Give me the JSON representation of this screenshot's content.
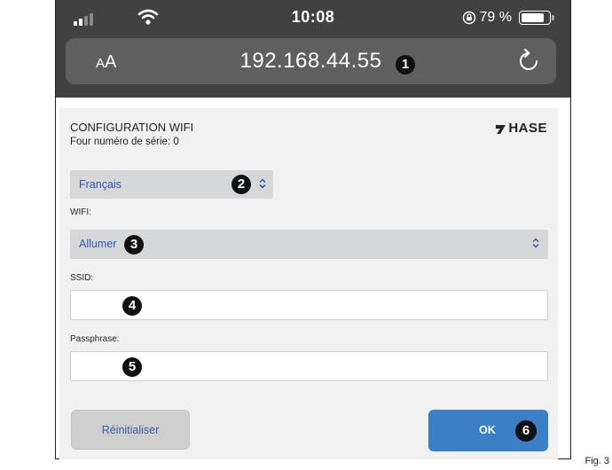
{
  "status_bar": {
    "time": "10:08",
    "battery": "79 %",
    "battery_level": 0.74
  },
  "browser": {
    "text_size_label_small": "A",
    "text_size_label_large": "A",
    "url": "192.168.44.55"
  },
  "markers": [
    "1",
    "2",
    "3",
    "4",
    "5",
    "6"
  ],
  "config": {
    "title": "CONFIGURATION WIFI",
    "subtitle": "Four numéro de série: 0",
    "logo": "HASE",
    "language": "Français",
    "wifi_label": "WIFI:",
    "wifi_value": "Allumer",
    "ssid_label": "SSID:",
    "ssid_value": "",
    "passphrase_label": "Passphrase:",
    "passphrase_value": "",
    "reset_label": "Réinitialiser",
    "ok_label": "OK"
  },
  "figure_label": "Fig. 3",
  "colors": {
    "browser_chrome": "#414141",
    "url_bar": "#5f5f5f",
    "panel_bg": "#f1f1f1",
    "select_bg": "#d6d7d9",
    "select_text": "#2f56a8",
    "ok_button": "#3b80c7",
    "reset_button": "#cfcfcf"
  }
}
